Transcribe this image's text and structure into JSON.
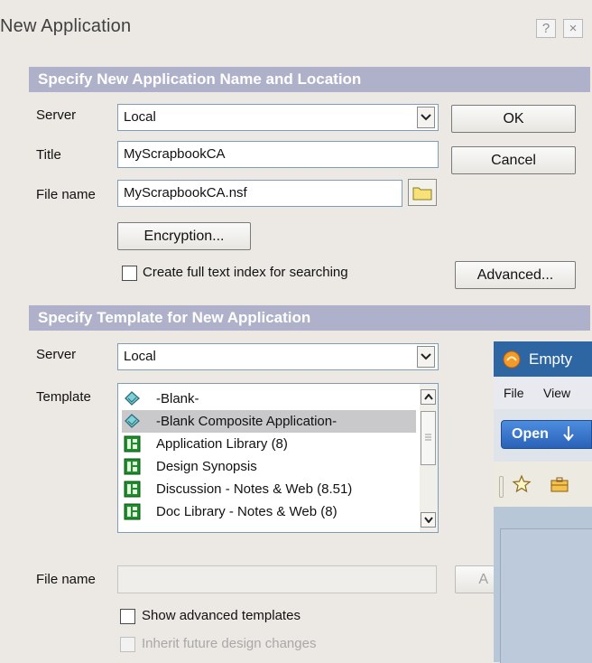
{
  "window": {
    "title": "New Application",
    "help_label": "?",
    "close_label": "×"
  },
  "sections": {
    "name_location": "Specify New Application Name and Location",
    "template": "Specify Template for New Application"
  },
  "app": {
    "server_label": "Server",
    "server_value": "Local",
    "title_label": "Title",
    "title_value": "MyScrapbookCA",
    "filename_label": "File name",
    "filename_value": "MyScrapbookCA.nsf",
    "encryption_label": "Encryption...",
    "fulltext_label": "Create full text index for searching",
    "fulltext_checked": false
  },
  "buttons": {
    "ok": "OK",
    "cancel": "Cancel",
    "advanced": "Advanced..."
  },
  "template": {
    "server_label": "Server",
    "server_value": "Local",
    "template_label": "Template",
    "items": [
      {
        "label": "-Blank-",
        "icon": "blank-template-icon",
        "selected": false
      },
      {
        "label": "-Blank Composite Application-",
        "icon": "blank-template-icon",
        "selected": true
      },
      {
        "label": "Application Library (8)",
        "icon": "notes-template-icon",
        "selected": false
      },
      {
        "label": "Design Synopsis",
        "icon": "notes-template-icon",
        "selected": false
      },
      {
        "label": "Discussion - Notes & Web (8.51)",
        "icon": "notes-template-icon",
        "selected": false
      },
      {
        "label": "Doc Library - Notes & Web (8)",
        "icon": "notes-template-icon",
        "selected": false
      }
    ],
    "filename_label": "File name",
    "filename_value": "",
    "about_button_label": "A",
    "show_advanced_label": "Show advanced templates",
    "show_advanced_checked": false,
    "inherit_label": "Inherit future design changes",
    "inherit_checked": false
  },
  "background_window": {
    "title": "Empty",
    "menu": [
      "File",
      "View"
    ],
    "open_button": "Open"
  },
  "colors": {
    "section_bar": "#aeb1c9",
    "dialog_bg": "#ece9e4",
    "selected_row": "#c9c9cc",
    "overlay_title": "#2d66a3"
  }
}
